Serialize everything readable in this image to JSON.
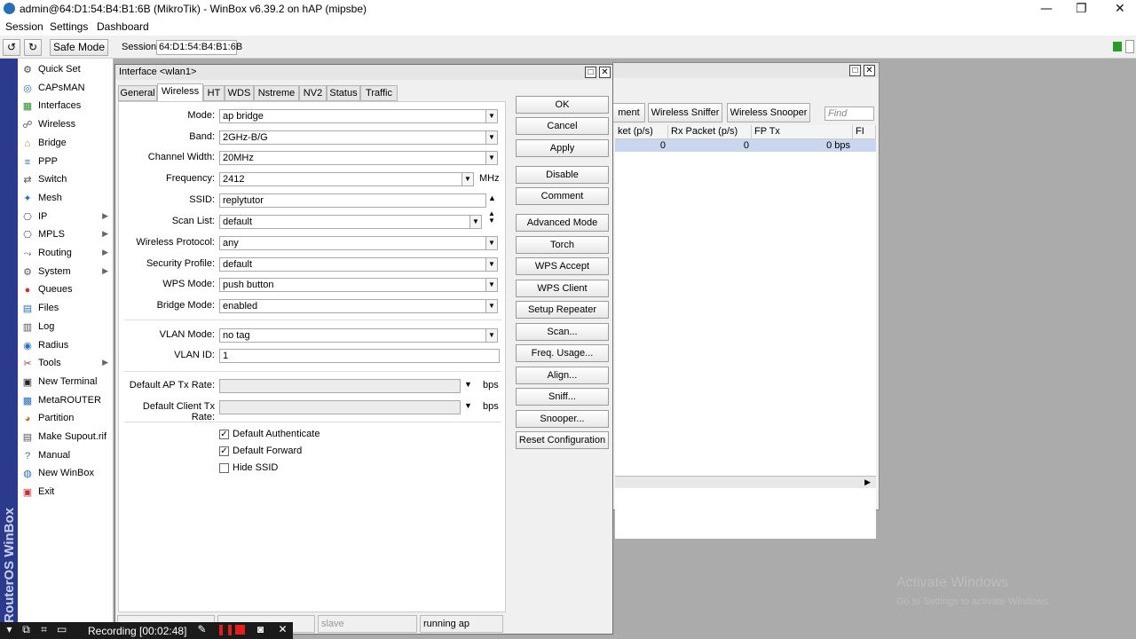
{
  "window": {
    "title": "admin@64:D1:54:B4:B1:6B (MikroTik) - WinBox v6.39.2 on hAP (mipsbe)",
    "minimize": "—",
    "maximize": "❐",
    "close": "✕"
  },
  "menu": [
    "Session",
    "Settings",
    "Dashboard"
  ],
  "toolbar": {
    "undo": "↺",
    "redo": "↻",
    "safe_mode": "Safe Mode",
    "session_label": "Session:",
    "session_value": "64:D1:54:B4:B1:6B"
  },
  "brand": "RouterOS WinBox",
  "sidebar": [
    {
      "label": "Quick Set",
      "icon": "quick-set-icon",
      "arrow": false
    },
    {
      "label": "CAPsMAN",
      "icon": "capsman-icon",
      "arrow": false
    },
    {
      "label": "Interfaces",
      "icon": "interfaces-icon",
      "arrow": false
    },
    {
      "label": "Wireless",
      "icon": "wireless-icon",
      "arrow": false
    },
    {
      "label": "Bridge",
      "icon": "bridge-icon",
      "arrow": false
    },
    {
      "label": "PPP",
      "icon": "ppp-icon",
      "arrow": false
    },
    {
      "label": "Switch",
      "icon": "switch-icon",
      "arrow": false
    },
    {
      "label": "Mesh",
      "icon": "mesh-icon",
      "arrow": false
    },
    {
      "label": "IP",
      "icon": "ip-icon",
      "arrow": true
    },
    {
      "label": "MPLS",
      "icon": "mpls-icon",
      "arrow": true
    },
    {
      "label": "Routing",
      "icon": "routing-icon",
      "arrow": true
    },
    {
      "label": "System",
      "icon": "system-icon",
      "arrow": true
    },
    {
      "label": "Queues",
      "icon": "queues-icon",
      "arrow": false
    },
    {
      "label": "Files",
      "icon": "files-icon",
      "arrow": false
    },
    {
      "label": "Log",
      "icon": "log-icon",
      "arrow": false
    },
    {
      "label": "Radius",
      "icon": "radius-icon",
      "arrow": false
    },
    {
      "label": "Tools",
      "icon": "tools-icon",
      "arrow": true
    },
    {
      "label": "New Terminal",
      "icon": "terminal-icon",
      "arrow": false
    },
    {
      "label": "MetaROUTER",
      "icon": "metarouter-icon",
      "arrow": false
    },
    {
      "label": "Partition",
      "icon": "partition-icon",
      "arrow": false
    },
    {
      "label": "Make Supout.rif",
      "icon": "supout-icon",
      "arrow": false
    },
    {
      "label": "Manual",
      "icon": "manual-icon",
      "arrow": false
    },
    {
      "label": "New WinBox",
      "icon": "winbox-icon",
      "arrow": false
    },
    {
      "label": "Exit",
      "icon": "exit-icon",
      "arrow": false
    }
  ],
  "backwin": {
    "tabs": [
      "ment",
      "Wireless Sniffer",
      "Wireless Snooper"
    ],
    "find_placeholder": "Find",
    "columns": [
      "ket (p/s)",
      "Rx Packet (p/s)",
      "FP Tx",
      "FI"
    ],
    "row": [
      "0",
      "0",
      "0 bps"
    ]
  },
  "dialog": {
    "title": "Interface <wlan1>",
    "tabs": [
      "General",
      "Wireless",
      "HT",
      "WDS",
      "Nstreme",
      "NV2",
      "Status",
      "Traffic"
    ],
    "active_tab": "Wireless",
    "fields": {
      "mode": {
        "label": "Mode:",
        "value": "ap bridge"
      },
      "band": {
        "label": "Band:",
        "value": "2GHz-B/G"
      },
      "channel_width": {
        "label": "Channel Width:",
        "value": "20MHz"
      },
      "frequency": {
        "label": "Frequency:",
        "value": "2412",
        "unit": "MHz"
      },
      "ssid": {
        "label": "SSID:",
        "value": "replytutor"
      },
      "scan_list": {
        "label": "Scan List:",
        "value": "default"
      },
      "wireless_protocol": {
        "label": "Wireless Protocol:",
        "value": "any"
      },
      "security_profile": {
        "label": "Security Profile:",
        "value": "default"
      },
      "wps_mode": {
        "label": "WPS Mode:",
        "value": "push button"
      },
      "bridge_mode": {
        "label": "Bridge Mode:",
        "value": "enabled"
      },
      "vlan_mode": {
        "label": "VLAN Mode:",
        "value": "no tag"
      },
      "vlan_id": {
        "label": "VLAN ID:",
        "value": "1"
      },
      "default_ap_tx_rate": {
        "label": "Default AP Tx Rate:",
        "value": "",
        "unit": "bps"
      },
      "default_client_tx_rate": {
        "label": "Default Client Tx Rate:",
        "value": "",
        "unit": "bps"
      }
    },
    "checkboxes": [
      {
        "label": "Default Authenticate",
        "checked": true
      },
      {
        "label": "Default Forward",
        "checked": true
      },
      {
        "label": "Hide SSID",
        "checked": false
      }
    ],
    "buttons": [
      "OK",
      "Cancel",
      "Apply",
      "Disable",
      "Comment",
      "Advanced Mode",
      "Torch",
      "WPS Accept",
      "WPS Client",
      "Setup Repeater",
      "Scan...",
      "Freq. Usage...",
      "Align...",
      "Sniff...",
      "Snooper...",
      "Reset Configuration"
    ],
    "status": [
      "",
      "",
      "slave",
      "running ap"
    ]
  },
  "recording": {
    "label": "Recording [00:02:48]"
  },
  "watermark": {
    "line1": "Activate Windows",
    "line2": "Go to Settings to activate Windows."
  }
}
